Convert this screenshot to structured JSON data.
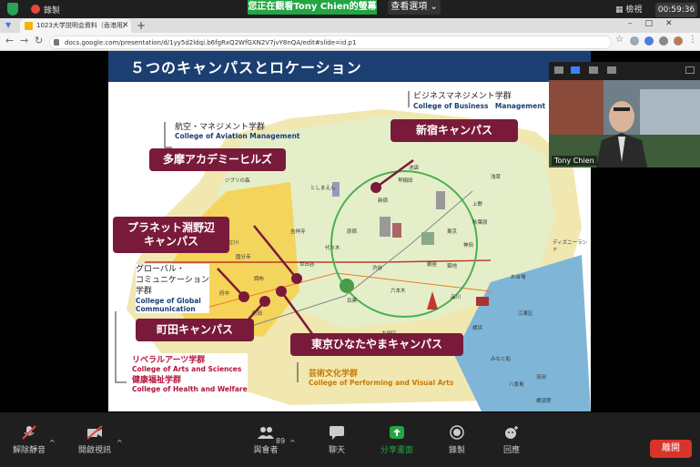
{
  "zoom": {
    "recording": "錄製",
    "viewing_banner": "您正在觀看Tony Chien的螢幕",
    "view_options": "查看選項",
    "view_button": "檢視",
    "timer": "00:59:36"
  },
  "browser": {
    "tab_title": "1023大学説明会資料（香港用）",
    "url": "docs.google.com/presentation/d/1yy5d2ldqi.b6fgRxQ2WfGXN2V7jvY8nQA/edit#slide=id.p1"
  },
  "slide": {
    "title": "５つのキャンパスとロケーション",
    "callouts": {
      "shinjuku": "新宿キャンパス",
      "tama": "多摩アカデミーヒルズ",
      "planet": "プラネット淵野辺\nキャンパス",
      "machida": "町田キャンパス",
      "hinatayama": "東京ひなたやまキャンパス"
    },
    "colleges": {
      "business_jp": "ビジネスマネジメント学群",
      "business_en": "College of Business　Management",
      "aviation_jp": "航空・マネジメント学群",
      "aviation_en": "College of Aviation Management",
      "global_jp": "グローバル・\nコミュニケーション\n学群",
      "global_en": "College of Global\nCommunication",
      "arts_jp": "リベラルアーツ学群",
      "arts_en": "College of Arts and Sciences",
      "health_jp": "健康福祉学群",
      "health_en": "College of Health and Welfare",
      "perform_jp": "芸術文化学群",
      "perform_en": "College of Performing and Visual Arts"
    },
    "places": [
      "ジブリの森",
      "としまえん",
      "八王子",
      "(山梨)",
      "立川",
      "吉祥寺",
      "国分寺",
      "府中",
      "調布",
      "世田谷",
      "町田",
      "新宿",
      "池袋",
      "東京",
      "上野",
      "浅草",
      "秋葉原",
      "品川",
      "渋谷",
      "六本木",
      "お台場",
      "大田区",
      "江東区",
      "代々木",
      "目黒",
      "銀座",
      "築地",
      "羽田",
      "ディズニーランド",
      "みなと船",
      "八景島",
      "横浜",
      "横須賀",
      "早稲田",
      "原宿",
      "神田"
    ]
  },
  "video": {
    "name": "Tony Chien"
  },
  "toolbar": {
    "mute": "解除靜音",
    "video": "開啟視訊",
    "participants": "與會者",
    "participants_count": "89",
    "chat": "聊天",
    "share": "分享畫面",
    "record": "錄製",
    "reactions": "回應",
    "leave": "離開"
  },
  "colors": {
    "zoom_green": "#23a543",
    "slide_header": "#1c3f72",
    "callout": "#7a1a3a",
    "leave_red": "#d9342b"
  }
}
